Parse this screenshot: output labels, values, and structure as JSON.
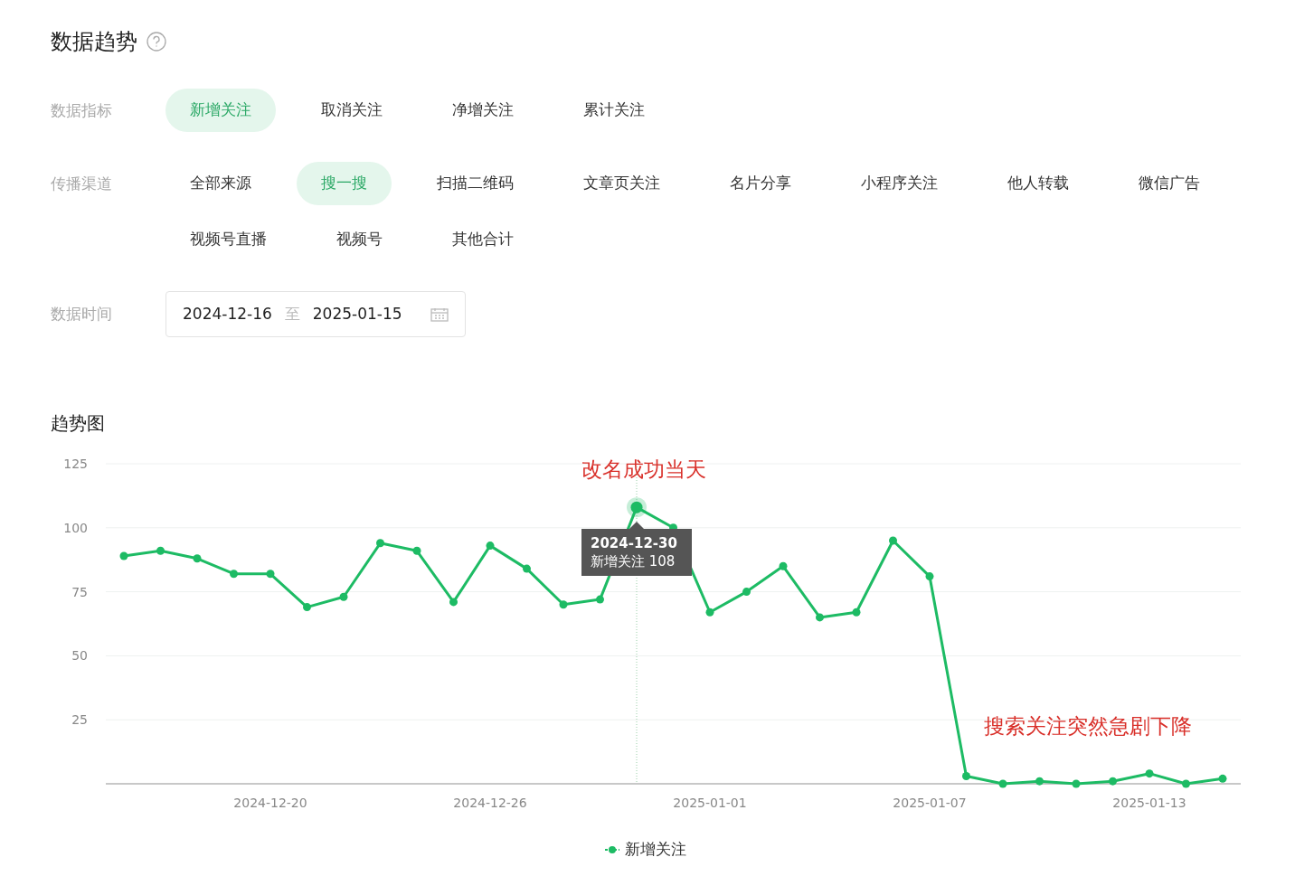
{
  "title": "数据趋势",
  "filters": [
    {
      "label": "数据指标",
      "options": [
        {
          "text": "新增关注",
          "selected": true
        },
        {
          "text": "取消关注",
          "selected": false
        },
        {
          "text": "净增关注",
          "selected": false
        },
        {
          "text": "累计关注",
          "selected": false
        }
      ]
    },
    {
      "label": "传播渠道",
      "options": [
        {
          "text": "全部来源",
          "selected": false
        },
        {
          "text": "搜一搜",
          "selected": true
        },
        {
          "text": "扫描二维码",
          "selected": false
        },
        {
          "text": "文章页关注",
          "selected": false
        },
        {
          "text": "名片分享",
          "selected": false
        },
        {
          "text": "小程序关注",
          "selected": false
        },
        {
          "text": "他人转载",
          "selected": false
        },
        {
          "text": "微信广告",
          "selected": false
        },
        {
          "text": "视频号直播",
          "selected": false
        },
        {
          "text": "视频号",
          "selected": false
        },
        {
          "text": "其他合计",
          "selected": false
        }
      ]
    }
  ],
  "date_range": {
    "label": "数据时间",
    "start": "2024-12-16",
    "separator": "至",
    "end": "2025-01-15"
  },
  "trend": {
    "title": "趋势图",
    "tooltip": {
      "title": "2024-12-30",
      "line": "新增关注 108"
    },
    "chart_data": {
      "type": "line",
      "grid": true,
      "categories": [
        null,
        null,
        null,
        null,
        "2024-12-20",
        null,
        null,
        null,
        null,
        null,
        "2024-12-26",
        null,
        null,
        null,
        null,
        null,
        "2025-01-01",
        null,
        null,
        null,
        null,
        null,
        "2025-01-07",
        null,
        null,
        null,
        null,
        null,
        "2025-01-13",
        null,
        null
      ],
      "series": [
        {
          "name": "新增关注",
          "color": "#1dbb64",
          "marker": "circle",
          "values": [
            89,
            91,
            88,
            82,
            82,
            69,
            73,
            94,
            91,
            71,
            93,
            84,
            70,
            72,
            108,
            100,
            67,
            75,
            85,
            65,
            67,
            95,
            81,
            3,
            0,
            1,
            0,
            1,
            4,
            0,
            2
          ]
        }
      ],
      "ylim": [
        0,
        125
      ],
      "yticks": [
        25,
        50,
        75,
        100,
        125
      ],
      "annotations": [
        "改名成功当天",
        "搜索关注突然急剧下降"
      ]
    }
  }
}
